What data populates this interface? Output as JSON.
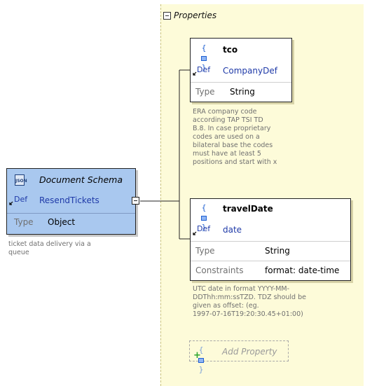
{
  "properties_panel": {
    "label": "Properties"
  },
  "root": {
    "title": "Document Schema",
    "def_tag": "Def",
    "def_ref": "ResendTickets",
    "type_label": "Type",
    "type_value": "Object",
    "description": [
      "ticket data delivery via a",
      "queue"
    ],
    "icon": "document-schema-icon"
  },
  "properties": [
    {
      "name": "tco",
      "def_tag": "Def",
      "def_ref": "CompanyDef",
      "type_label": "Type",
      "type_value": "String",
      "description": [
        "ERA company code",
        "according TAP TSI TD",
        "B.8. In case proprietary",
        "codes are used on a",
        "bilateral base the codes",
        "must have at least 5",
        "positions and start with x"
      ]
    },
    {
      "name": "travelDate",
      "def_tag": "Def",
      "def_ref": "date",
      "type_label": "Type",
      "type_value": "String",
      "constraints_label": "Constraints",
      "constraints_value": "format: date-time",
      "description": [
        "UTC date in format YYYY-MM-",
        "DDThh:mm:ssTZD. TDZ should be",
        "given as offset: (eg.",
        "1997-07-16T19:20:30.45+01:00)"
      ]
    }
  ],
  "add_property": {
    "label": "Add Property"
  },
  "colors": {
    "panel_bg": "#fdfbd9",
    "root_bg": "#a9c8ef",
    "def_link": "#1f3aa8"
  }
}
